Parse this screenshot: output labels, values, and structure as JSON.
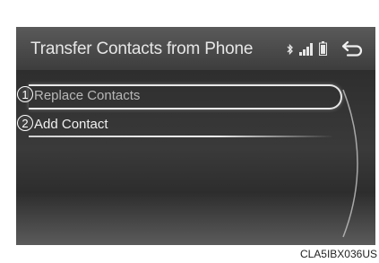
{
  "header": {
    "title": "Transfer Contacts from Phone",
    "icons": [
      "bluetooth-icon",
      "signal-icon",
      "battery-icon",
      "back-icon"
    ]
  },
  "list": {
    "items": [
      {
        "callout": "1",
        "label": "Replace Contacts"
      },
      {
        "callout": "2",
        "label": "Add Contact"
      }
    ]
  },
  "figure_code": "CLA5IBX036US"
}
